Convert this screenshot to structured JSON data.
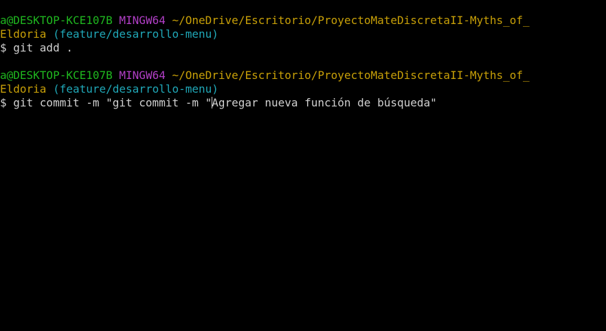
{
  "prompt1": {
    "user_host": "a@DESKTOP-KCE107B",
    "env": "MINGW64",
    "path_line1": "~/OneDrive/Escritorio/ProyectoMateDiscretaII-Myths_of_",
    "path_line2": "Eldoria",
    "branch": "(feature/desarrollo-menu)"
  },
  "command1": "$ git add .",
  "prompt2": {
    "user_host": "a@DESKTOP-KCE107B",
    "env": "MINGW64",
    "path_line1": "~/OneDrive/Escritorio/ProyectoMateDiscretaII-Myths_of_",
    "path_line2": "Eldoria",
    "branch": "(feature/desarrollo-menu)"
  },
  "command2_before_cursor": "$ git commit -m \"git commit -m \"",
  "command2_after_cursor": "Agregar nueva función de búsqueda\"",
  "colors": {
    "background": "#000000",
    "user_host": "#1fb71f",
    "env": "#b23fc7",
    "path": "#c8a008",
    "branch": "#20a8b8",
    "text": "#d0d0d0"
  }
}
